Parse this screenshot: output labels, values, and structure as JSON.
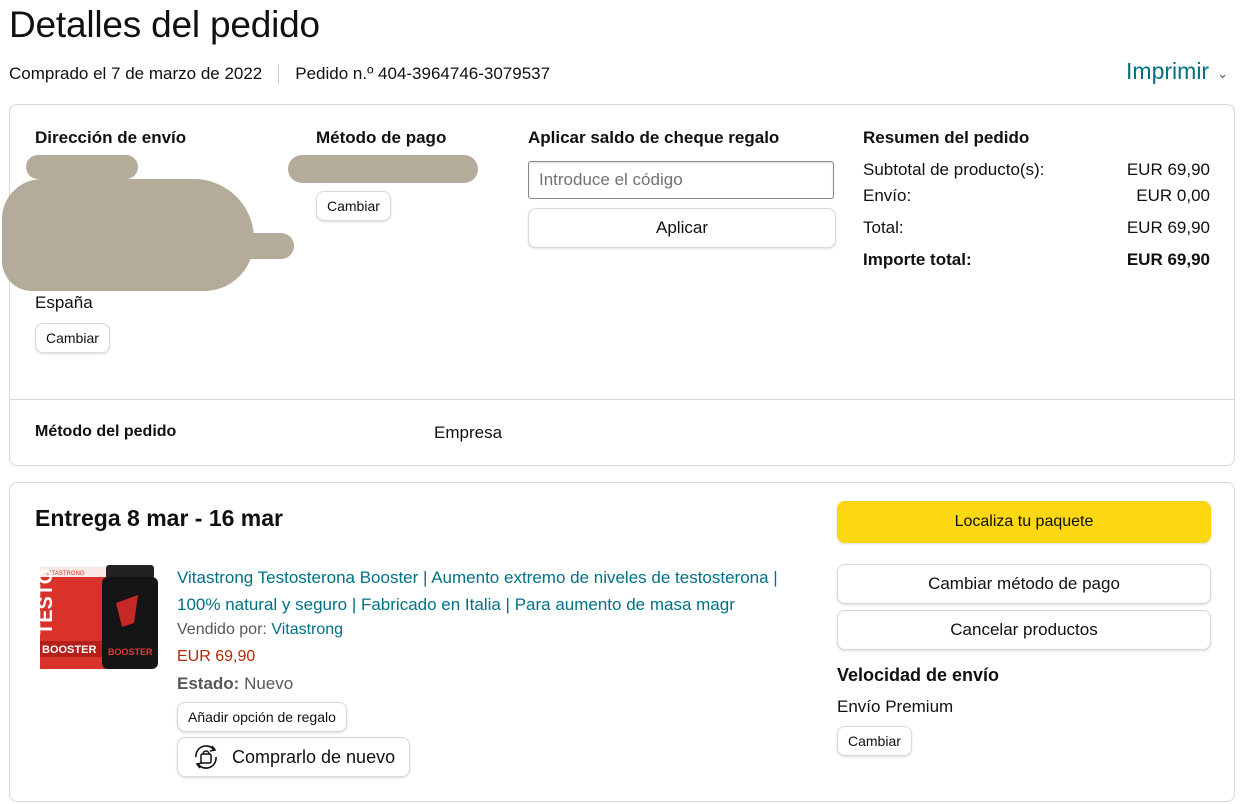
{
  "page": {
    "title": "Detalles del pedido",
    "purchased": "Comprado el 7 de marzo de 2022",
    "order_number": "Pedido n.º 404-3964746-3079537",
    "print_label": "Imprimir"
  },
  "summary_card": {
    "shipping": {
      "heading": "Dirección de envío",
      "country": "España",
      "change_label": "Cambiar"
    },
    "payment": {
      "heading": "Método de pago",
      "change_label": "Cambiar"
    },
    "gift": {
      "heading": "Aplicar saldo de cheque regalo",
      "placeholder": "Introduce el código",
      "apply_label": "Aplicar"
    },
    "order_summary": {
      "heading": "Resumen del pedido",
      "rows": [
        {
          "label": "Subtotal de producto(s):",
          "value": "EUR 69,90"
        },
        {
          "label": "Envío:",
          "value": "EUR 0,00"
        },
        {
          "label": "Total:",
          "value": "EUR 69,90"
        },
        {
          "label": "Importe total:",
          "value": "EUR 69,90"
        }
      ]
    },
    "order_method": {
      "label": "Método del pedido",
      "value": "Empresa"
    }
  },
  "delivery_card": {
    "heading": "Entrega 8 mar - 16 mar",
    "product": {
      "title": "Vitastrong Testosterona Booster | Aumento extremo de niveles de testosterona | 100% natural y seguro | Fabricado en Italia | Para aumento de masa magr",
      "sold_by_label": "Vendido por:",
      "seller": "Vitastrong",
      "price": "EUR 69,90",
      "condition_label": "Estado:",
      "condition": "Nuevo",
      "image_text": {
        "brand": "VITASTRONG",
        "word1": "TESTO",
        "word2": "BOOSTER",
        "jar_word": "BOOSTER"
      }
    },
    "gift_option_label": "Añadir opción de regalo",
    "buy_again_label": "Comprarlo de nuevo",
    "actions": {
      "track_label": "Localiza tu paquete",
      "change_payment_label": "Cambiar método de pago",
      "cancel_label": "Cancelar productos"
    },
    "shipping_speed": {
      "heading": "Velocidad de envío",
      "value": "Envío Premium",
      "change_label": "Cambiar"
    }
  },
  "colors": {
    "link": "#007185",
    "price": "#b12704",
    "primary_button": "#ffd814",
    "redaction": "#b5ab9b"
  }
}
